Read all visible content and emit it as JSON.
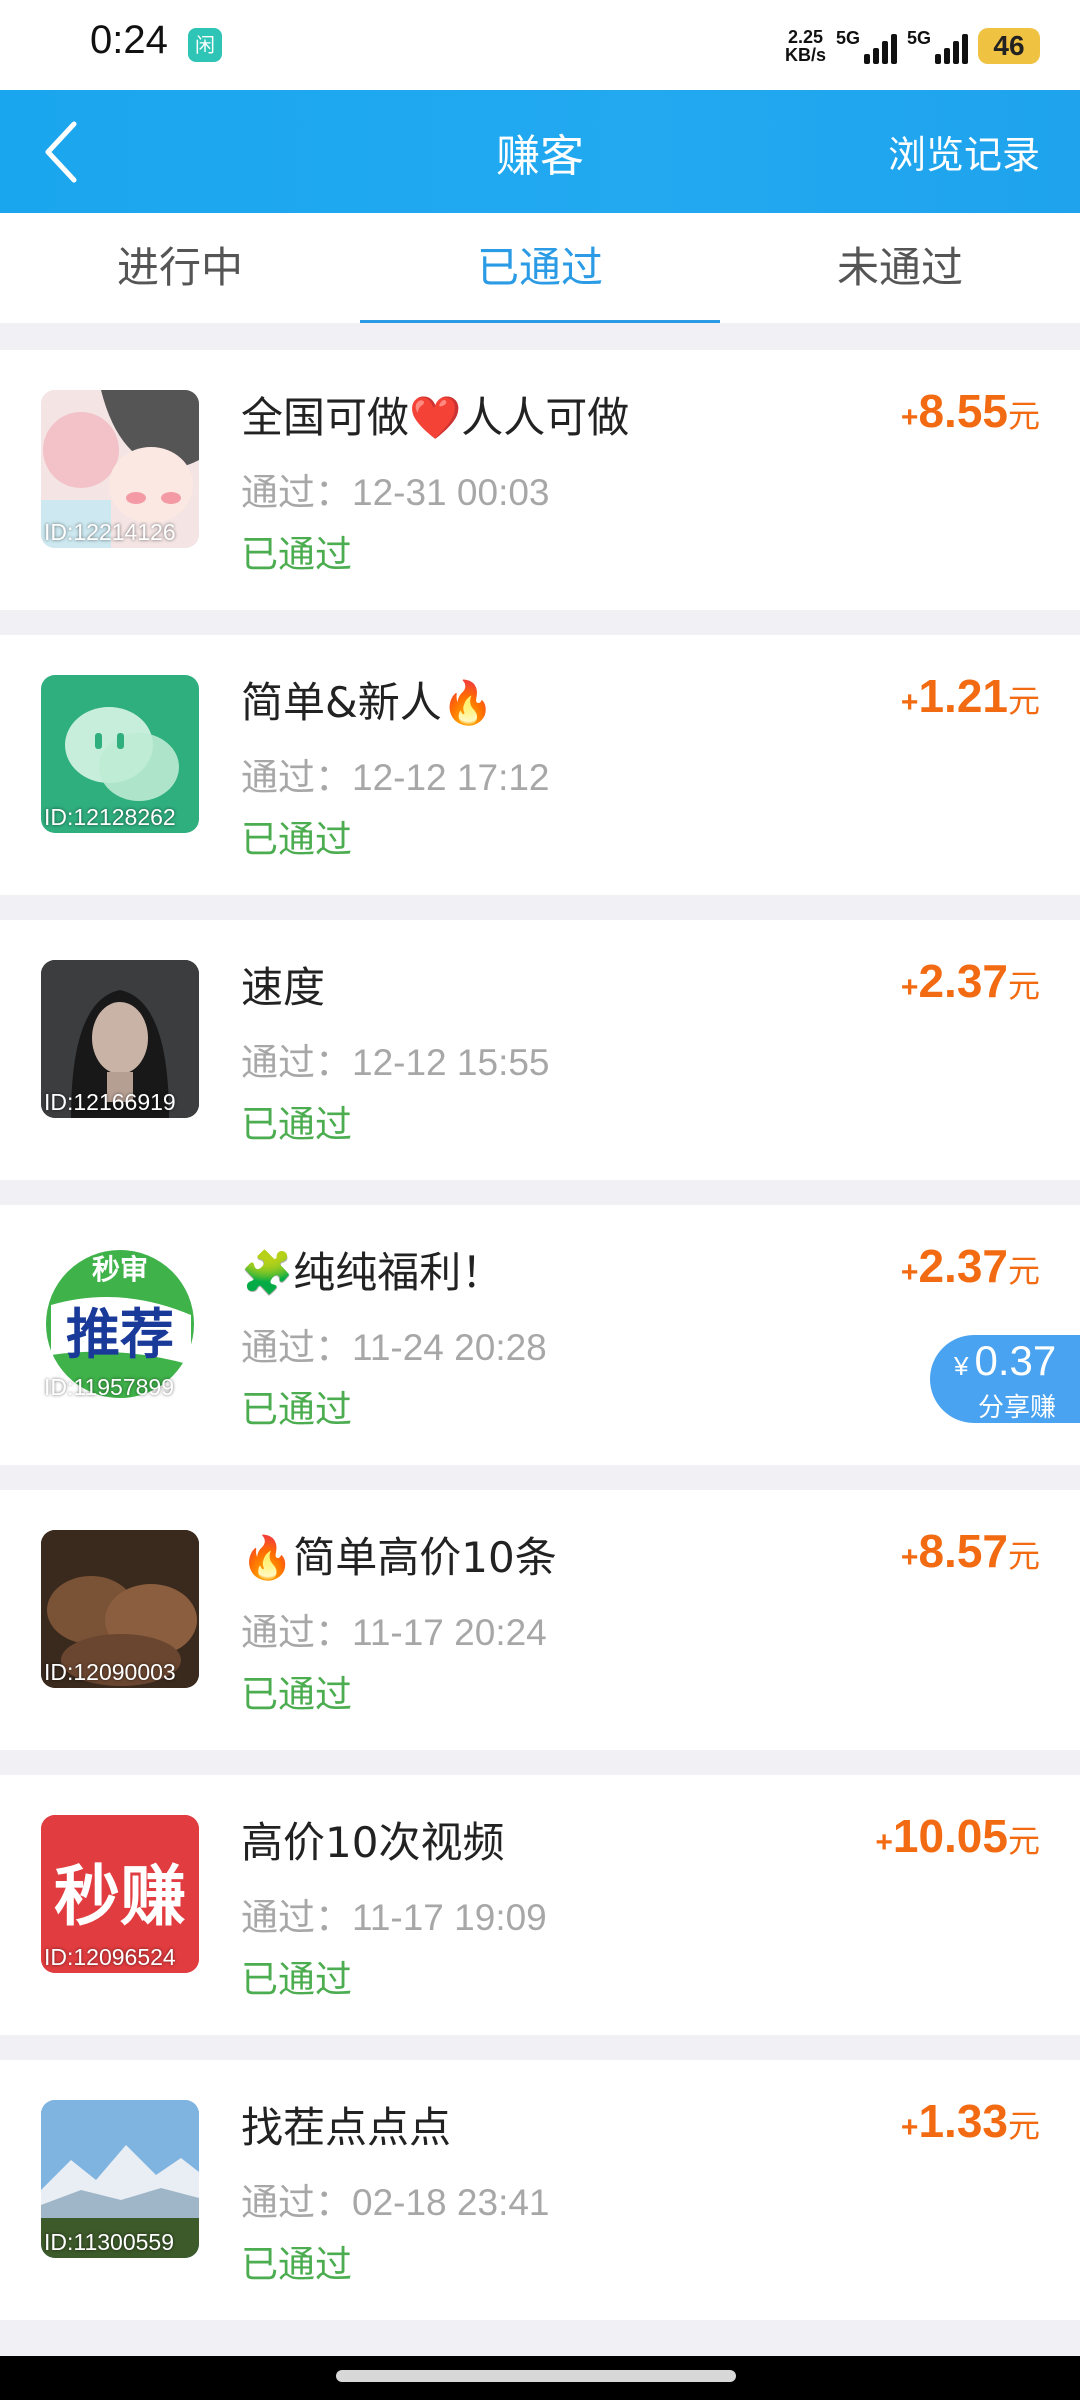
{
  "status_bar": {
    "time": "0:24",
    "app_icon_glyph": "闲",
    "net_speed_value": "2.25",
    "net_speed_unit": "KB/s",
    "sim1_label": "5G",
    "sim2_label": "5G",
    "battery": "46"
  },
  "header": {
    "title": "赚客",
    "history_label": "浏览记录"
  },
  "tabs": [
    {
      "label": "进行中"
    },
    {
      "label": "已通过"
    },
    {
      "label": "未通过"
    }
  ],
  "items": [
    {
      "thumb_id": "ID:12214126",
      "title": "全国可做❤️人人可做",
      "date": "通过：12-31 00:03",
      "status": "已通过",
      "plus": "+",
      "amount": "8.55",
      "unit": "元"
    },
    {
      "thumb_id": "ID:12128262",
      "title": "简单&新人🔥",
      "date": "通过：12-12 17:12",
      "status": "已通过",
      "plus": "+",
      "amount": "1.21",
      "unit": "元"
    },
    {
      "thumb_id": "ID:12166919",
      "title": "速度",
      "date": "通过：12-12 15:55",
      "status": "已通过",
      "plus": "+",
      "amount": "2.37",
      "unit": "元"
    },
    {
      "thumb_id": "ID:11957899",
      "title": "🧩纯纯福利！",
      "date": "通过：11-24 20:28",
      "status": "已通过",
      "plus": "+",
      "amount": "2.37",
      "unit": "元",
      "thumb_text_top": "秒审",
      "thumb_text_main": "推荐"
    },
    {
      "thumb_id": "ID:12090003",
      "title": "🔥简单高价10条",
      "date": "通过：11-17 20:24",
      "status": "已通过",
      "plus": "+",
      "amount": "8.57",
      "unit": "元"
    },
    {
      "thumb_id": "ID:12096524",
      "title": "高价10次视频",
      "date": "通过：11-17 19:09",
      "status": "已通过",
      "plus": "+",
      "amount": "10.05",
      "unit": "元",
      "thumb_text_main": "秒赚"
    },
    {
      "thumb_id": "ID:11300559",
      "title": "找茬点点点",
      "date": "通过：02-18 23:41",
      "status": "已通过",
      "plus": "+",
      "amount": "1.33",
      "unit": "元"
    }
  ],
  "share_badge": {
    "currency": "¥",
    "amount": "0.37",
    "label": "分享赚"
  },
  "colors": {
    "header_blue": "#1ea6ee",
    "tab_active": "#2a9be4",
    "amount_orange": "#f26b12",
    "status_green": "#4cad50"
  }
}
